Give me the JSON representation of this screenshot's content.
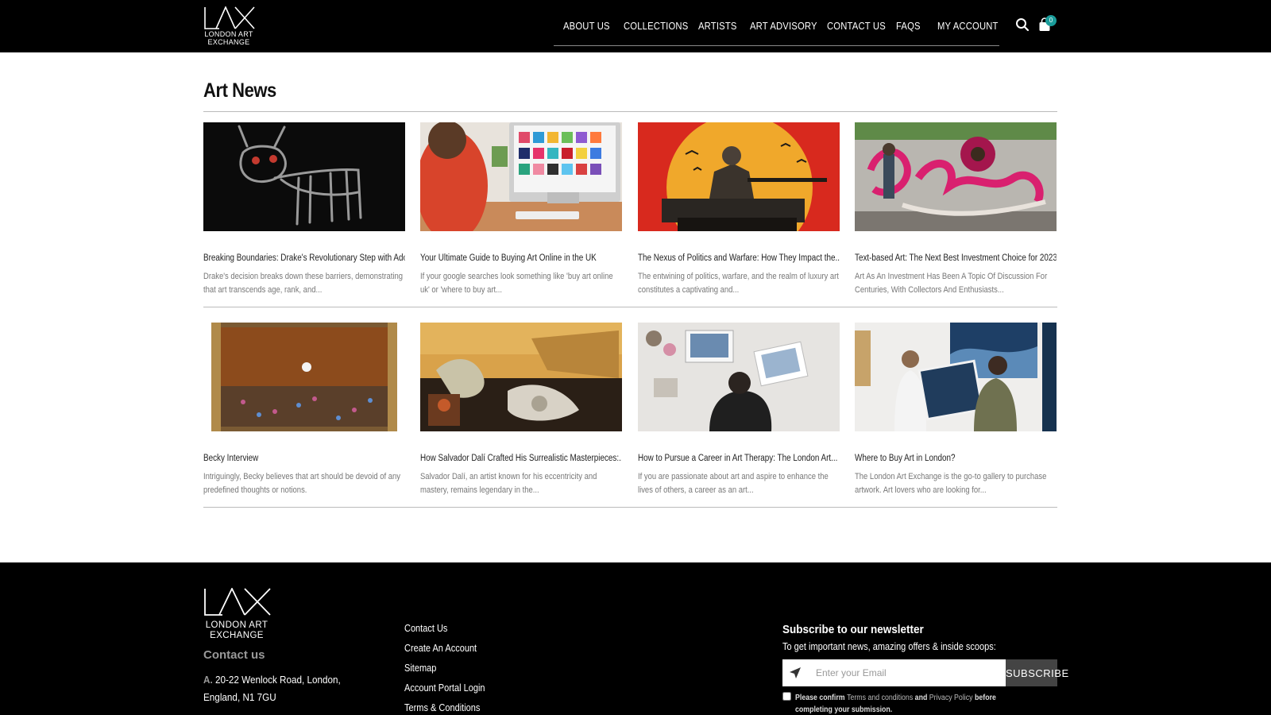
{
  "header": {
    "logo": {
      "mark": "LAX",
      "line1": "LONDON ART",
      "line2": "EXCHANGE"
    },
    "nav": [
      {
        "label": "ABOUT US"
      },
      {
        "label": "COLLECTIONS"
      },
      {
        "label": "ARTISTS"
      },
      {
        "label": "ART ADVISORY"
      },
      {
        "label": "CONTACT US"
      },
      {
        "label": "FAQS"
      },
      {
        "label": "MY ACCOUNT"
      }
    ],
    "icons": {
      "search": "search-icon",
      "cart": "shopping-bag-icon"
    },
    "cart_count": "0"
  },
  "main": {
    "title": "Art News",
    "articles": [
      {
        "title": "Breaking Boundaries: Drake's Revolutionary Step with Adonis...",
        "excerpt": "Drake's decision breaks down these barriers, demonstrating that art transcends age, rank, and..."
      },
      {
        "title": "Your Ultimate Guide to Buying Art Online in the UK",
        "excerpt": "If your google searches look something like 'buy art online uk' or 'where to buy art..."
      },
      {
        "title": "The Nexus of Politics and Warfare: How They Impact the...",
        "excerpt": "The entwining of politics, warfare, and the realm of luxury art constitutes a captivating and..."
      },
      {
        "title": "Text-based Art: The Next Best Investment Choice for 2023",
        "excerpt": "Art As An Investment Has Been A Topic Of Discussion For Centuries, With Collectors And Enthusiasts..."
      },
      {
        "title": "Becky Interview",
        "excerpt": "Intriguingly, Becky believes that art should be devoid of any predefined thoughts or notions."
      },
      {
        "title": "How Salvador Dalí Crafted His Surrealistic Masterpieces:...",
        "excerpt": "Salvador Dalí, an artist known for his eccentricity and mastery, remains legendary in the..."
      },
      {
        "title": "How to Pursue a Career in Art Therapy: The London Art...",
        "excerpt": "If you are passionate about art and aspire to enhance the lives of others, a career as an art..."
      },
      {
        "title": "Where to Buy Art in London?",
        "excerpt": "The London Art Exchange is the go-to gallery to purchase artwork. Art lovers who are looking for..."
      }
    ]
  },
  "footer": {
    "logo": {
      "mark": "LAX",
      "line1": "LONDON ART",
      "line2": "EXCHANGE"
    },
    "contact_title": "Contact us",
    "address_label": "A.",
    "address": "20-22 Wenlock Road, London, England, N1 7GU",
    "links": [
      {
        "label": "Contact Us"
      },
      {
        "label": "Create An Account"
      },
      {
        "label": "Sitemap"
      },
      {
        "label": "Account Portal Login"
      },
      {
        "label": "Terms & Conditions"
      }
    ],
    "newsletter": {
      "title": "Subscribe to our newsletter",
      "subtitle": "To get important news, amazing offers & inside scoops:",
      "placeholder": "Enter your Email",
      "button": "SUBSCRIBE",
      "consent_pre": "Please confirm",
      "consent_terms": "Terms and conditions",
      "consent_and": "and",
      "consent_privacy": "Privacy Policy",
      "consent_post": "before completing your submission."
    }
  }
}
